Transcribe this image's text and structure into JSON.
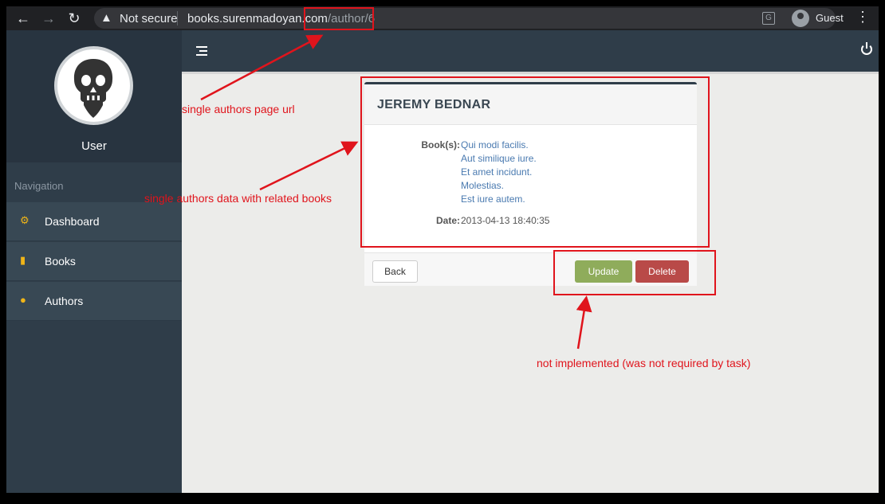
{
  "browser": {
    "not_secure_label": "Not secure",
    "url_host": "books.surenmadoyan.com",
    "url_path": "/author/6",
    "profile_name": "Guest"
  },
  "sidebar": {
    "username": "User",
    "nav_heading": "Navigation",
    "items": [
      {
        "label": "Dashboard",
        "icon": "cogs-icon"
      },
      {
        "label": "Books",
        "icon": "book-icon"
      },
      {
        "label": "Authors",
        "icon": "user-icon"
      }
    ]
  },
  "author": {
    "name": "JEREMY BEDNAR",
    "books_label": "Book(s):",
    "books": [
      "Qui modi facilis.",
      "Aut similique iure.",
      "Et amet incidunt.",
      "Molestias.",
      "Est iure autem."
    ],
    "date_label": "Date:",
    "date": "2013-04-13 18:40:35"
  },
  "actions": {
    "back": "Back",
    "update": "Update",
    "delete": "Delete"
  },
  "annotations": {
    "url_note": "single authors page url",
    "data_note": "single authors data with related books",
    "actions_note": "not implemented (was not required by task)"
  },
  "colors": {
    "annotation_red": "#e0141c",
    "sidebar_bg": "#2f3d49",
    "update_green": "#8fac5b",
    "delete_red": "#b94a48",
    "link_blue": "#4a7ab0",
    "icon_yellow": "#f0b518"
  }
}
